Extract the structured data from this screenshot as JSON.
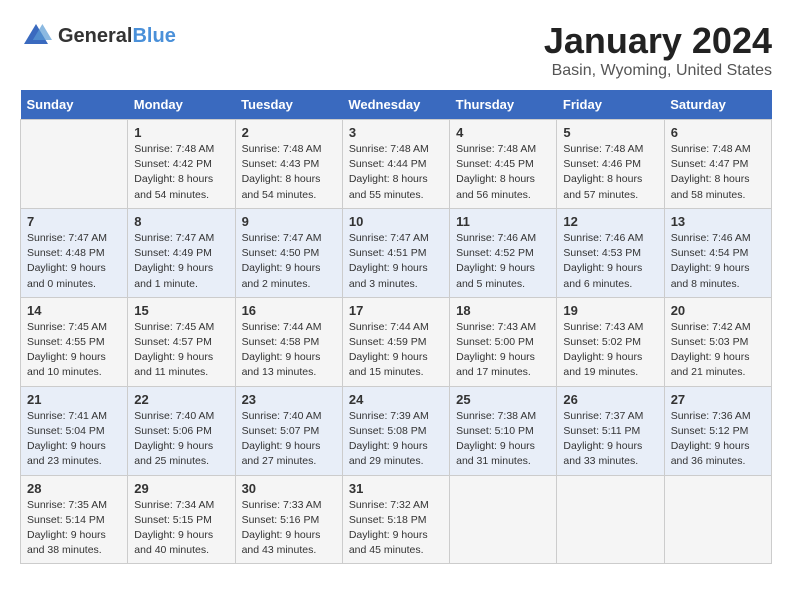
{
  "header": {
    "logo_general": "General",
    "logo_blue": "Blue",
    "main_title": "January 2024",
    "subtitle": "Basin, Wyoming, United States"
  },
  "days_of_week": [
    "Sunday",
    "Monday",
    "Tuesday",
    "Wednesday",
    "Thursday",
    "Friday",
    "Saturday"
  ],
  "weeks": [
    [
      {
        "day": "",
        "info": ""
      },
      {
        "day": "1",
        "info": "Sunrise: 7:48 AM\nSunset: 4:42 PM\nDaylight: 8 hours\nand 54 minutes."
      },
      {
        "day": "2",
        "info": "Sunrise: 7:48 AM\nSunset: 4:43 PM\nDaylight: 8 hours\nand 54 minutes."
      },
      {
        "day": "3",
        "info": "Sunrise: 7:48 AM\nSunset: 4:44 PM\nDaylight: 8 hours\nand 55 minutes."
      },
      {
        "day": "4",
        "info": "Sunrise: 7:48 AM\nSunset: 4:45 PM\nDaylight: 8 hours\nand 56 minutes."
      },
      {
        "day": "5",
        "info": "Sunrise: 7:48 AM\nSunset: 4:46 PM\nDaylight: 8 hours\nand 57 minutes."
      },
      {
        "day": "6",
        "info": "Sunrise: 7:48 AM\nSunset: 4:47 PM\nDaylight: 8 hours\nand 58 minutes."
      }
    ],
    [
      {
        "day": "7",
        "info": "Sunrise: 7:47 AM\nSunset: 4:48 PM\nDaylight: 9 hours\nand 0 minutes."
      },
      {
        "day": "8",
        "info": "Sunrise: 7:47 AM\nSunset: 4:49 PM\nDaylight: 9 hours\nand 1 minute."
      },
      {
        "day": "9",
        "info": "Sunrise: 7:47 AM\nSunset: 4:50 PM\nDaylight: 9 hours\nand 2 minutes."
      },
      {
        "day": "10",
        "info": "Sunrise: 7:47 AM\nSunset: 4:51 PM\nDaylight: 9 hours\nand 3 minutes."
      },
      {
        "day": "11",
        "info": "Sunrise: 7:46 AM\nSunset: 4:52 PM\nDaylight: 9 hours\nand 5 minutes."
      },
      {
        "day": "12",
        "info": "Sunrise: 7:46 AM\nSunset: 4:53 PM\nDaylight: 9 hours\nand 6 minutes."
      },
      {
        "day": "13",
        "info": "Sunrise: 7:46 AM\nSunset: 4:54 PM\nDaylight: 9 hours\nand 8 minutes."
      }
    ],
    [
      {
        "day": "14",
        "info": "Sunrise: 7:45 AM\nSunset: 4:55 PM\nDaylight: 9 hours\nand 10 minutes."
      },
      {
        "day": "15",
        "info": "Sunrise: 7:45 AM\nSunset: 4:57 PM\nDaylight: 9 hours\nand 11 minutes."
      },
      {
        "day": "16",
        "info": "Sunrise: 7:44 AM\nSunset: 4:58 PM\nDaylight: 9 hours\nand 13 minutes."
      },
      {
        "day": "17",
        "info": "Sunrise: 7:44 AM\nSunset: 4:59 PM\nDaylight: 9 hours\nand 15 minutes."
      },
      {
        "day": "18",
        "info": "Sunrise: 7:43 AM\nSunset: 5:00 PM\nDaylight: 9 hours\nand 17 minutes."
      },
      {
        "day": "19",
        "info": "Sunrise: 7:43 AM\nSunset: 5:02 PM\nDaylight: 9 hours\nand 19 minutes."
      },
      {
        "day": "20",
        "info": "Sunrise: 7:42 AM\nSunset: 5:03 PM\nDaylight: 9 hours\nand 21 minutes."
      }
    ],
    [
      {
        "day": "21",
        "info": "Sunrise: 7:41 AM\nSunset: 5:04 PM\nDaylight: 9 hours\nand 23 minutes."
      },
      {
        "day": "22",
        "info": "Sunrise: 7:40 AM\nSunset: 5:06 PM\nDaylight: 9 hours\nand 25 minutes."
      },
      {
        "day": "23",
        "info": "Sunrise: 7:40 AM\nSunset: 5:07 PM\nDaylight: 9 hours\nand 27 minutes."
      },
      {
        "day": "24",
        "info": "Sunrise: 7:39 AM\nSunset: 5:08 PM\nDaylight: 9 hours\nand 29 minutes."
      },
      {
        "day": "25",
        "info": "Sunrise: 7:38 AM\nSunset: 5:10 PM\nDaylight: 9 hours\nand 31 minutes."
      },
      {
        "day": "26",
        "info": "Sunrise: 7:37 AM\nSunset: 5:11 PM\nDaylight: 9 hours\nand 33 minutes."
      },
      {
        "day": "27",
        "info": "Sunrise: 7:36 AM\nSunset: 5:12 PM\nDaylight: 9 hours\nand 36 minutes."
      }
    ],
    [
      {
        "day": "28",
        "info": "Sunrise: 7:35 AM\nSunset: 5:14 PM\nDaylight: 9 hours\nand 38 minutes."
      },
      {
        "day": "29",
        "info": "Sunrise: 7:34 AM\nSunset: 5:15 PM\nDaylight: 9 hours\nand 40 minutes."
      },
      {
        "day": "30",
        "info": "Sunrise: 7:33 AM\nSunset: 5:16 PM\nDaylight: 9 hours\nand 43 minutes."
      },
      {
        "day": "31",
        "info": "Sunrise: 7:32 AM\nSunset: 5:18 PM\nDaylight: 9 hours\nand 45 minutes."
      },
      {
        "day": "",
        "info": ""
      },
      {
        "day": "",
        "info": ""
      },
      {
        "day": "",
        "info": ""
      }
    ]
  ]
}
